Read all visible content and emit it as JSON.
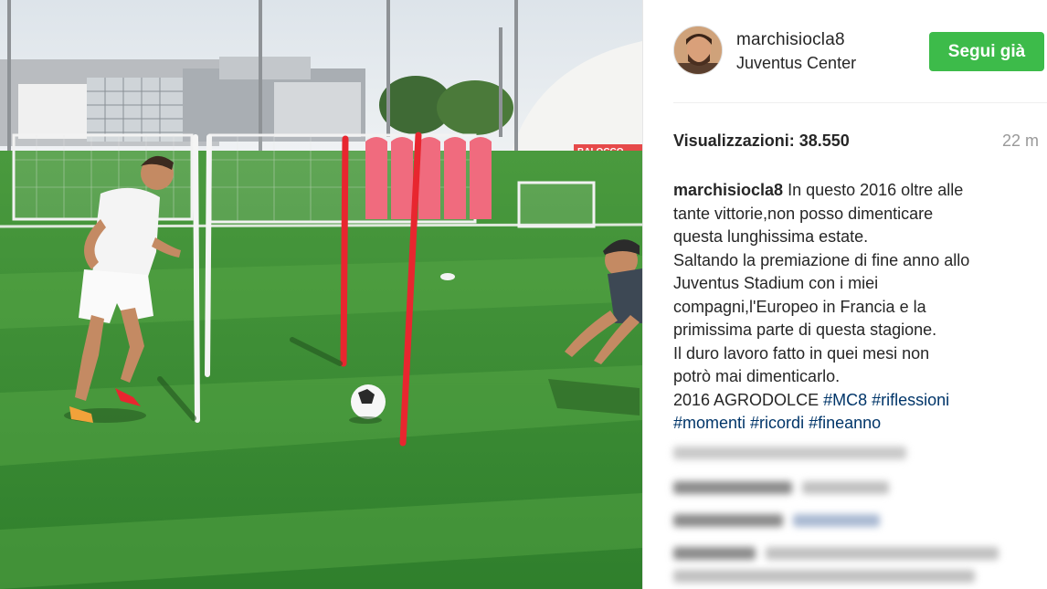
{
  "post": {
    "username": "marchisiocla8",
    "location": "Juventus Center",
    "follow_label": "Segui già",
    "views_label": "Visualizzazioni: 38.550",
    "time_ago": "22 m",
    "caption": {
      "author": "marchisiocla8",
      "lines": [
        " In questo 2016 oltre alle",
        "tante vittorie,non posso dimenticare",
        "questa lunghissima estate.",
        "Saltando la premiazione di fine anno allo",
        "Juventus Stadium con i miei",
        "compagni,l'Europeo in Francia e la",
        "primissima parte di questa stagione.",
        "Il duro lavoro fatto in quei mesi non",
        "potrò mai dimenticarlo.",
        "2016 AGRODOLCE "
      ],
      "hashtags_line1": [
        "#MC8",
        "#riflessioni"
      ],
      "hashtags_line2": [
        "#momenti",
        "#ricordi",
        "#fineanno"
      ]
    }
  },
  "media": {
    "sign_text": "BALOCCO"
  },
  "colors": {
    "follow_green": "#3dbb4a",
    "hashtag": "#003569",
    "text": "#262626",
    "muted": "#999999"
  }
}
